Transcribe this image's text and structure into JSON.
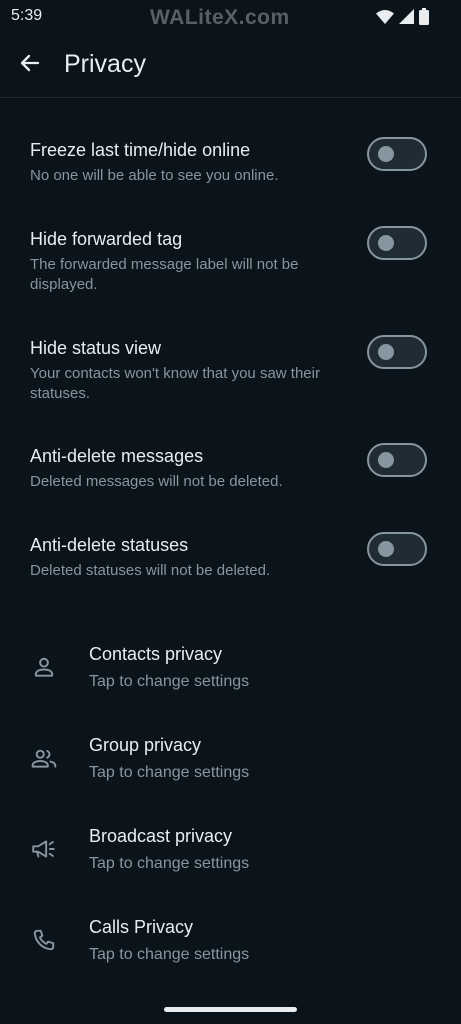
{
  "status_bar": {
    "time": "5:39",
    "watermark": "WALiteX.com",
    "icons": [
      "wifi-icon",
      "signal-icon",
      "battery-icon"
    ]
  },
  "app_bar": {
    "title": "Privacy",
    "back_icon": "arrow-left-icon"
  },
  "toggles": [
    {
      "title": "Freeze last time/hide online",
      "subtitle": "No one will be able to see you online.",
      "enabled": false
    },
    {
      "title": "Hide forwarded tag",
      "subtitle": "The forwarded message label will not be displayed.",
      "enabled": false
    },
    {
      "title": "Hide status view",
      "subtitle": "Your contacts won't know that you saw their statuses.",
      "enabled": false
    },
    {
      "title": "Anti-delete messages",
      "subtitle": "Deleted messages will not be deleted.",
      "enabled": false
    },
    {
      "title": "Anti-delete statuses",
      "subtitle": "Deleted statuses will not be deleted.",
      "enabled": false
    }
  ],
  "privacy_items": [
    {
      "title": "Contacts privacy",
      "subtitle": "Tap to change settings",
      "icon": "person-icon"
    },
    {
      "title": "Group privacy",
      "subtitle": "Tap to change settings",
      "icon": "group-icon"
    },
    {
      "title": "Broadcast privacy",
      "subtitle": "Tap to change settings",
      "icon": "megaphone-icon"
    },
    {
      "title": "Calls Privacy",
      "subtitle": "Tap to change settings",
      "icon": "phone-icon"
    }
  ],
  "colors": {
    "background": "#0b141a",
    "primary_text": "#e9edef",
    "secondary_text": "#8696a0",
    "switch_track": "#1f2c34",
    "switch_off": "#8696a0"
  }
}
